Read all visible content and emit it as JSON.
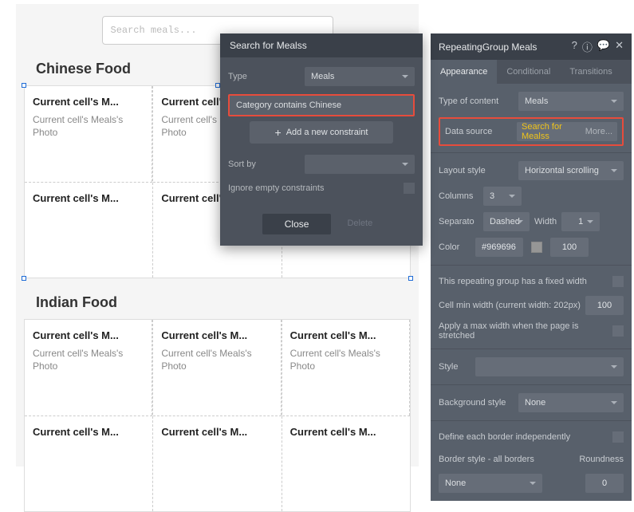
{
  "canvas": {
    "search_placeholder": "Search meals...",
    "sections": [
      {
        "title": "Chinese Food",
        "cells": [
          "Current cell's M...",
          "Current cell's M...",
          "Current cell's M...",
          "Current cell's M..."
        ],
        "photo_label": "Current cell's Meals's Photo"
      },
      {
        "title": "Indian Food",
        "cells": [
          "Current cell's M...",
          "Current cell's M...",
          "Current cell's M...",
          "Current cell's M...",
          "Current cell's M...",
          "Current cell's M..."
        ],
        "photo_label": "Current cell's Meals's Photo"
      }
    ]
  },
  "dialog": {
    "title": "Search for Mealss",
    "type_label": "Type",
    "type_value": "Meals",
    "constraint": "Category contains  Chinese",
    "add_constraint": "Add a new constraint",
    "sort_label": "Sort by",
    "ignore_label": "Ignore empty constraints",
    "close": "Close",
    "delete": "Delete"
  },
  "panel": {
    "title": "RepeatingGroup Meals",
    "tabs": {
      "appearance": "Appearance",
      "conditional": "Conditional",
      "transitions": "Transitions"
    },
    "type_of_content_label": "Type of content",
    "type_of_content": "Meals",
    "data_source_label": "Data source",
    "data_source_value": "Search for Mealss",
    "data_source_more": "More...",
    "layout_style_label": "Layout style",
    "layout_style": "Horizontal scrolling",
    "columns_label": "Columns",
    "columns": "3",
    "separator_label": "Separato",
    "separator": "Dashed",
    "width_label": "Width",
    "width": "1",
    "color_label": "Color",
    "color_hex": "#969696",
    "color_alpha": "100",
    "fixed_width_label": "This repeating group has a fixed width",
    "cell_min_width_label": "Cell min width (current width: 202px)",
    "cell_min_width": "100",
    "apply_max_label": "Apply a max width when the page is stretched",
    "style_label": "Style",
    "bg_style_label": "Background style",
    "bg_style": "None",
    "border_indep_label": "Define each border independently",
    "border_style_label": "Border style - all borders",
    "roundness_label": "Roundness",
    "border_style": "None",
    "roundness": "0"
  }
}
